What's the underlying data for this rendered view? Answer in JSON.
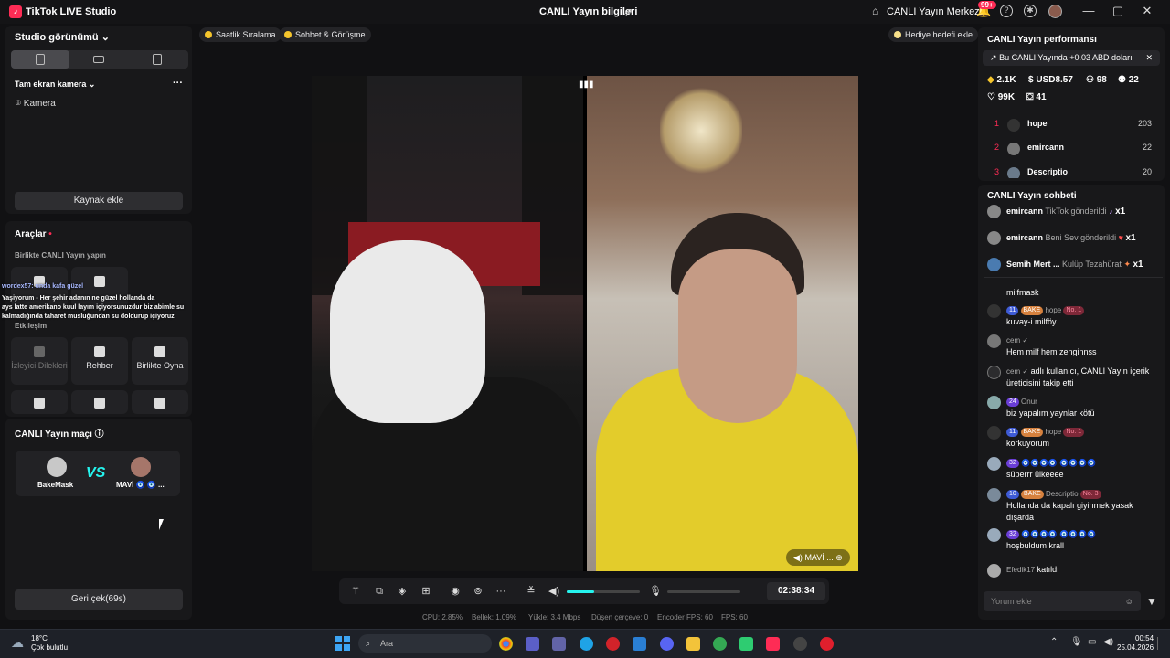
{
  "titlebar": {
    "app_name": "TikTok LIVE Studio",
    "center_title": "CANLI Yayın bilgileri",
    "live_center": "CANLI Yayın Merkezi",
    "notifications_badge": "99+"
  },
  "left": {
    "studio_view": "Studio görünümü",
    "fullscreen_camera": "Tam ekran kamera",
    "camera": "Kamera",
    "add_source": "Kaynak ekle",
    "tools_title": "Araçlar",
    "go_live_together": "Birlikte CANLI Yayın yapın",
    "interaction": "Etkileşim",
    "tools": [
      {
        "label": "İzleyici Dilekleri",
        "icon": "viewer-requests-icon"
      },
      {
        "label": "Rehber",
        "icon": "guide-icon"
      },
      {
        "label": "Birlikte Oyna",
        "icon": "play-together-icon"
      }
    ],
    "overlay_lines": [
      "wordex57: unda kafa güzel",
      "Yaşiyorum - Her şehir adanın ne güzel hollanda da",
      "ays latte amerikano kuul layım içiyorsunuzdur biz abimle su",
      "kalmadığında taharet musluğundan su doldurup içiyoruz"
    ],
    "match_title": "CANLI Yayın maçı",
    "match_left": "BakeMask",
    "match_right": "MAVİ 🧿 🧿 ...",
    "retract": "Geri çek(69s)"
  },
  "top_chips": {
    "hourly_rank": "Saatlik Sıralama",
    "chat_meet": "Sohbet & Görüşme",
    "add_gift_goal": "Hediye hedefi ekle"
  },
  "stage": {
    "guest_tag": "MAVİ ..."
  },
  "controls": {
    "timer": "02:38:34",
    "volume_level": 0.38
  },
  "stats": {
    "cpu": "CPU:  2.85%",
    "memory": "Bellek:  1.09%",
    "upload": "Yükle:  3.4 Mbps",
    "dropped": "Düşen çerçeve:  0",
    "encoder_fps": "Encoder FPS:  60",
    "fps": "FPS:  60"
  },
  "performance": {
    "title": "CANLI Yayın performansı",
    "note": "Bu CANLI Yayında +0.03 ABD doları",
    "diamonds": "2.1K",
    "usd": "USD8.57",
    "viewers": "98",
    "new_followers": "22",
    "likes": "99K",
    "gifts": "41",
    "ranking": [
      {
        "rank": "1",
        "name": "hope",
        "value": "203"
      },
      {
        "rank": "2",
        "name": "emircann",
        "value": "22"
      },
      {
        "rank": "3",
        "name": "Descriptio",
        "value": "20"
      }
    ]
  },
  "chat": {
    "title": "CANLI Yayın sohbeti",
    "gifts": [
      {
        "user": "emircann",
        "text": "TikTok gönderildi",
        "count": "x1"
      },
      {
        "user": "emircann",
        "text": "Beni Sev gönderildi",
        "count": "x1"
      },
      {
        "user": "Semih Mert ...",
        "text": "Kulüp Tezahürat",
        "count": "x1"
      }
    ],
    "partial_top": "milfmask",
    "messages": [
      {
        "lvl": "11",
        "fan": "BAKE",
        "user": "hope",
        "no": "No. 1",
        "text": "kuvay-i milföy"
      },
      {
        "lvl": "",
        "fan": "",
        "user": "cem ✓",
        "no": "",
        "text": "Hem milf hem zenginnss"
      },
      {
        "lvl": "",
        "fan": "",
        "user": "cem ✓",
        "no": "",
        "text": "adlı kullanıcı, CANLI Yayın içerik üreticisini takip etti"
      },
      {
        "lvl": "24",
        "fan": "",
        "user": "Onur",
        "no": "",
        "text": "biz yapalım yaynlar kötü"
      },
      {
        "lvl": "11",
        "fan": "BAKE",
        "user": "hope",
        "no": "No. 1",
        "text": "korkuyorum"
      },
      {
        "lvl": "32",
        "fan": "",
        "user": "🧿🧿🧿🧿 🧿🧿🧿🧿",
        "no": "",
        "text": "süperrr ülkeeee"
      },
      {
        "lvl": "10",
        "fan": "BAKE",
        "user": "Descriptio",
        "no": "No. 3",
        "text": "Hollanda da kapalı giyinmek yasak dışarda"
      },
      {
        "lvl": "32",
        "fan": "",
        "user": "🧿🧿🧿🧿 🧿🧿🧿🧿",
        "no": "",
        "text": "hoşbuldum krall"
      }
    ],
    "join": {
      "user": "Efedik17",
      "text": "katıldı"
    },
    "input_placeholder": "Yorum ekle"
  },
  "taskbar": {
    "temp": "18°C",
    "weather": "Çok bulutlu",
    "search": "Ara",
    "time": "00:54",
    "date": "25.04.2026"
  }
}
